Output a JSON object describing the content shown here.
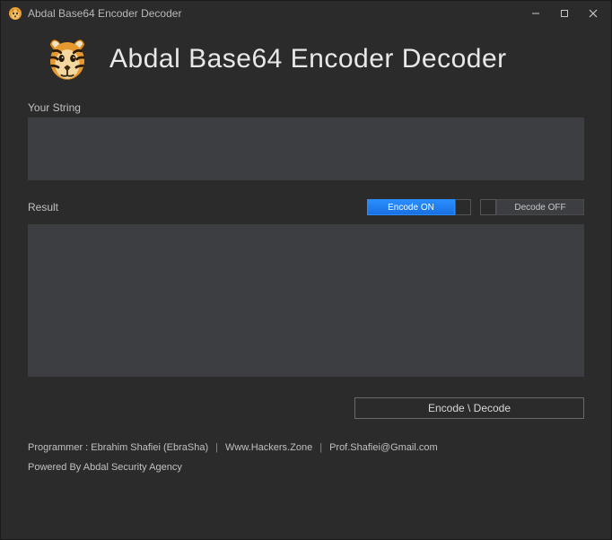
{
  "window": {
    "title": "Abdal Base64 Encoder Decoder"
  },
  "header": {
    "title": "Abdal Base64 Encoder Decoder"
  },
  "input": {
    "label": "Your String",
    "value": ""
  },
  "toggles": {
    "encode": "Encode ON",
    "decode": "Decode OFF"
  },
  "result": {
    "label": "Result",
    "value": ""
  },
  "action": {
    "label": "Encode \\ Decode"
  },
  "footer": {
    "programmer_label": "Programmer : Ebrahim Shafiei (EbraSha)",
    "site": "Www.Hackers.Zone",
    "email": "Prof.Shafiei@Gmail.com",
    "powered": "Powered By Abdal Security Agency"
  }
}
